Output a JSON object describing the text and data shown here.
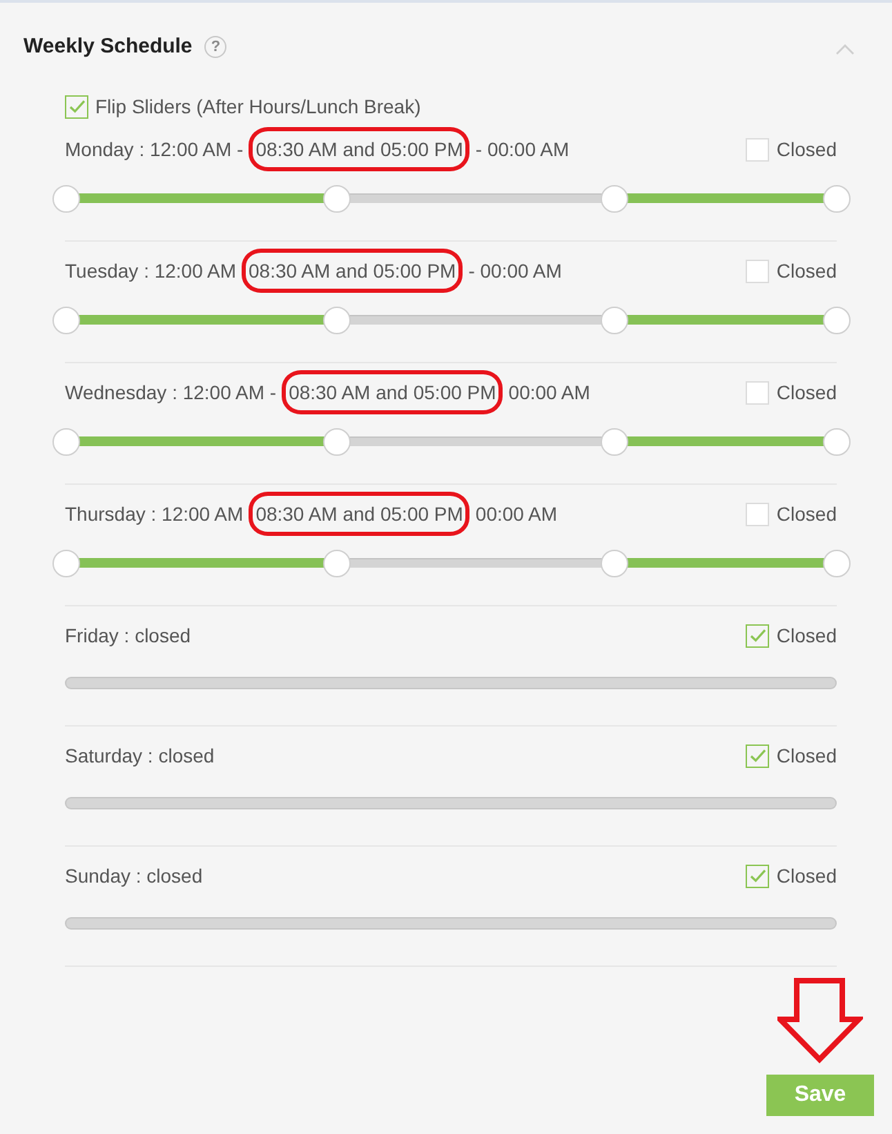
{
  "panel": {
    "title": "Weekly Schedule",
    "help": "?",
    "expanded": true
  },
  "flip_sliders": {
    "label": "Flip Sliders (After Hours/Lunch Break)",
    "checked": true
  },
  "days": [
    {
      "kind": "range",
      "start": "Monday : 12:00 AM -",
      "highlight": "08:30 AM and 05:00 PM",
      "end": "- 00:00 AM",
      "highlighted": true,
      "closed": false,
      "closed_label": "Closed",
      "handles": [
        {
          "level": 0
        },
        {
          "level": 0.352
        },
        {
          "level": 0.711
        },
        {
          "level": 1
        }
      ]
    },
    {
      "kind": "range",
      "start": "Tuesday : 12:00 AM",
      "highlight": "08:30 AM and 05:00 PM",
      "end": "- 00:00 AM",
      "highlighted": true,
      "closed": false,
      "closed_label": "Closed",
      "handles": [
        {
          "level": 0
        },
        {
          "level": 0.352
        },
        {
          "level": 0.711
        },
        {
          "level": 1
        }
      ]
    },
    {
      "kind": "range",
      "start": "Wednesday : 12:00 AM -",
      "highlight": "08:30 AM and 05:00 PM",
      "end": "00:00 AM",
      "highlighted": true,
      "closed": false,
      "closed_label": "Closed",
      "handles": [
        {
          "level": 0
        },
        {
          "level": 0.352
        },
        {
          "level": 0.711
        },
        {
          "level": 1
        }
      ]
    },
    {
      "kind": "range",
      "start": "Thursday : 12:00 AM",
      "highlight": "08:30 AM and 05:00 PM",
      "end": "00:00 AM",
      "highlighted": true,
      "closed": false,
      "closed_label": "Closed",
      "handles": [
        {
          "level": 0
        },
        {
          "level": 0.352
        },
        {
          "level": 0.711
        },
        {
          "level": 1
        }
      ]
    },
    {
      "kind": "closed_day",
      "label": "Friday : closed",
      "closed": true,
      "closed_label": "Closed"
    },
    {
      "kind": "closed_day",
      "label": "Saturday : closed",
      "closed": true,
      "closed_label": "Closed"
    },
    {
      "kind": "closed_day",
      "label": "Sunday : closed",
      "closed": true,
      "closed_label": "Closed"
    }
  ],
  "save_button": {
    "label": "Save",
    "annotated": true
  }
}
